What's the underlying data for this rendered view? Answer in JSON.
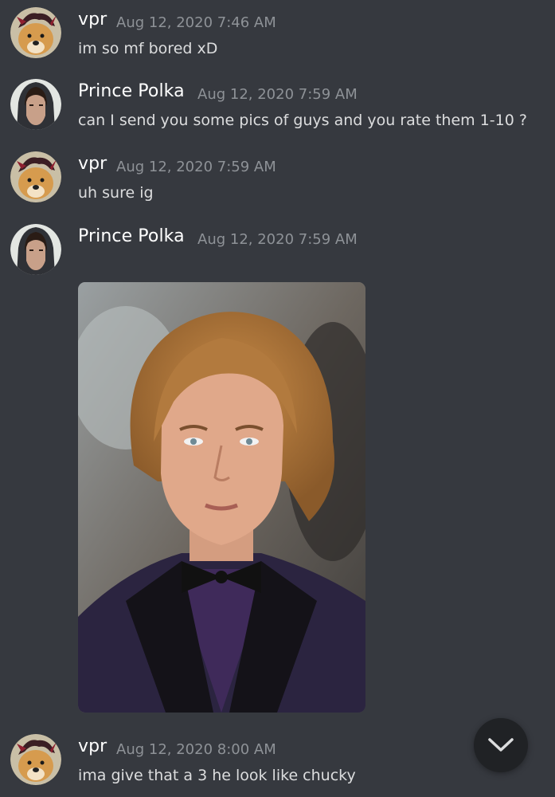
{
  "messages": [
    {
      "author": "vpr",
      "timestamp": "Aug 12, 2020 7:46 AM",
      "text": "im so mf bored xD",
      "avatar": "dog-avatar-icon"
    },
    {
      "author": "Prince Polka",
      "timestamp": "Aug 12, 2020 7:59 AM",
      "text": "can I send you some pics of guys and you rate them 1-10 ?",
      "avatar": "hooded-man-avatar-icon"
    },
    {
      "author": "vpr",
      "timestamp": "Aug 12, 2020 7:59 AM",
      "text": "uh sure ig",
      "avatar": "dog-avatar-icon"
    },
    {
      "author": "Prince Polka",
      "timestamp": "Aug 12, 2020 7:59 AM",
      "attachment": "photo of a man with wavy blonde hair in a purple tuxedo",
      "avatar": "hooded-man-avatar-icon"
    },
    {
      "author": "vpr",
      "timestamp": "Aug 12, 2020 8:00 AM",
      "text": "ima give that a 3 he look like chucky",
      "avatar": "dog-avatar-icon"
    }
  ],
  "scroll_button": {
    "icon": "chevron-down-icon"
  },
  "colors": {
    "background": "#36393f",
    "username": "#ffffff",
    "timestamp": "#8e9297",
    "message_text": "#dcddde",
    "scroll_button": "#202225"
  }
}
